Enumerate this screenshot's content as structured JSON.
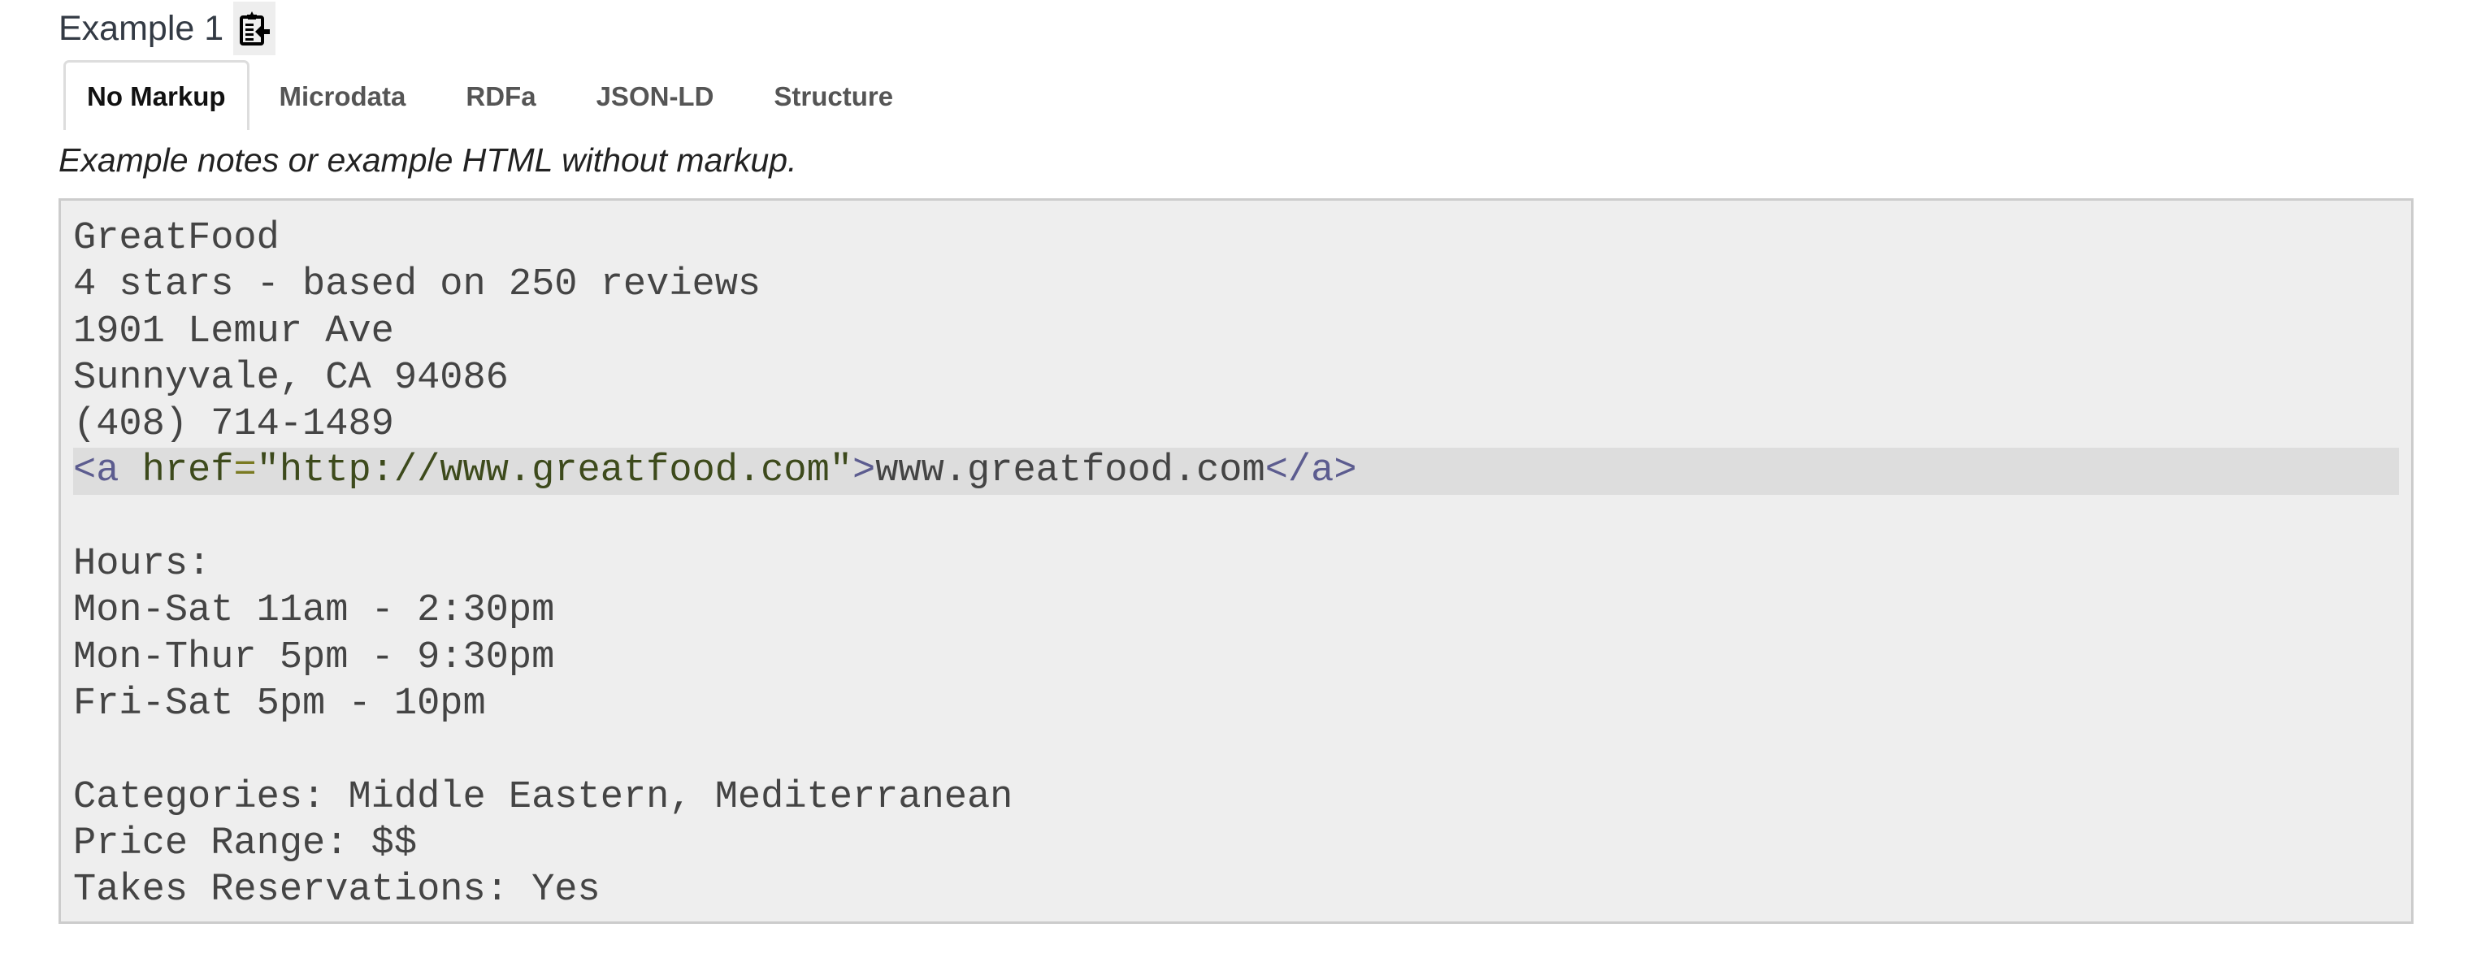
{
  "header": {
    "title": "Example 1",
    "copy_icon": "clipboard-paste-icon"
  },
  "tabs": [
    {
      "label": "No Markup",
      "active": true
    },
    {
      "label": "Microdata",
      "active": false
    },
    {
      "label": "RDFa",
      "active": false
    },
    {
      "label": "JSON-LD",
      "active": false
    },
    {
      "label": "Structure",
      "active": false
    }
  ],
  "note": "Example notes or example HTML without markup.",
  "code": {
    "lines_before": [
      "GreatFood",
      "4 stars - based on 250 reviews",
      "1901 Lemur Ave",
      "Sunnyvale, CA 94086",
      "(408) 714-1489"
    ],
    "link_line": {
      "open_tag_start": "<a",
      "attr_name": " href",
      "equals": "=",
      "attr_value": "\"http://www.greatfood.com\"",
      "open_tag_end": ">",
      "text": "www.greatfood.com",
      "close_tag": "</a>"
    },
    "lines_after": [
      "",
      "Hours:",
      "Mon-Sat 11am - 2:30pm",
      "Mon-Thur 5pm - 9:30pm",
      "Fri-Sat 5pm - 10pm",
      "",
      "Categories: Middle Eastern, Mediterranean",
      "Price Range: $$",
      "Takes Reservations: Yes"
    ]
  },
  "colors": {
    "code_background": "#eeeeee",
    "highlight_line": "#dddddd",
    "tag": "#5c5c8f",
    "attribute": "#3d4a1c"
  }
}
